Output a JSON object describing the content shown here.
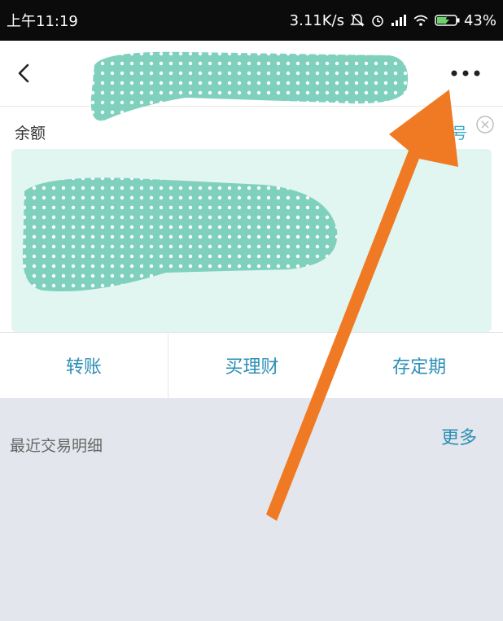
{
  "status_bar": {
    "time": "上午11:19",
    "network_speed": "3.11K/s",
    "battery_percent": "43%",
    "icons": [
      "mute-icon",
      "alarm-icon",
      "signal-icon",
      "wifi-icon",
      "battery-charging-icon"
    ]
  },
  "header": {
    "back_icon": "chevron-left-icon",
    "more_icon": "more-dots-icon"
  },
  "balance": {
    "label": "余额",
    "show_account_link": "显示账号",
    "close_icon": "close-circle-icon"
  },
  "actions": [
    {
      "label": "转账"
    },
    {
      "label": "买理财"
    },
    {
      "label": "存定期"
    }
  ],
  "recent": {
    "title": "最近交易明细",
    "more_label": "更多"
  },
  "colors": {
    "accent": "#2c8fb5",
    "link": "#3aa6c8",
    "card_bg": "#e1f5f1",
    "redaction": "#7fd1bd",
    "annotation_arrow": "#f07a24",
    "page_bg": "#e3e6ec"
  }
}
